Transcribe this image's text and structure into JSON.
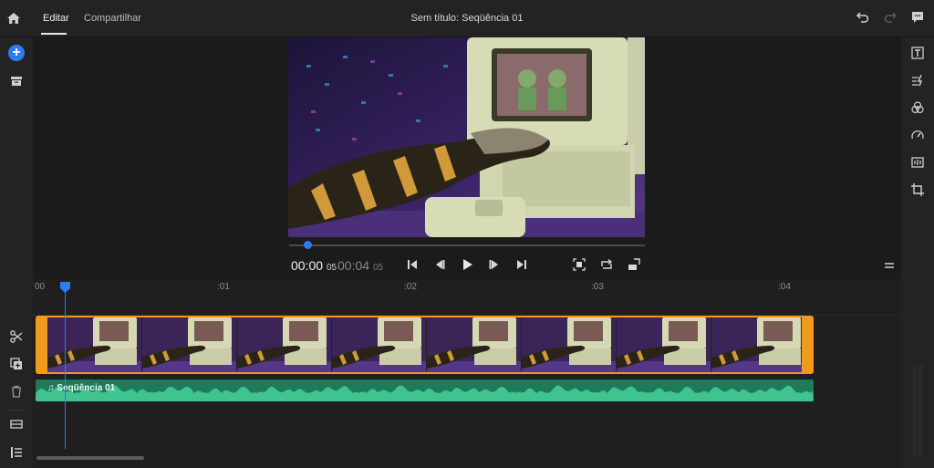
{
  "header": {
    "tabs": [
      {
        "label": "Editar",
        "active": true
      },
      {
        "label": "Compartilhar",
        "active": false
      }
    ],
    "title": "Sem título: Seqüência 01",
    "icons": [
      "home-icon",
      "undo-icon",
      "redo-icon",
      "comment-icon"
    ]
  },
  "left_rail": {
    "icons": [
      "add-icon",
      "archive-icon",
      "scissors-icon",
      "duplicate-icon",
      "trash-icon",
      "track-icon",
      "list-icon"
    ]
  },
  "right_rail": {
    "icons": [
      "titles-icon",
      "transitions-icon",
      "color-icon",
      "speed-icon",
      "audio-icon",
      "crop-icon"
    ]
  },
  "player": {
    "current_time": "00:00",
    "current_frames": "05",
    "total_time": "00:04",
    "total_frames": "05",
    "progress": 0.05
  },
  "timeline": {
    "ruler_ticks": [
      "00",
      ":01",
      ":02",
      ":03",
      ":04"
    ],
    "audio_track_label": "Seqüência 01"
  },
  "colors": {
    "accent": "#2c7cf5",
    "video_clip": "#f29a1b",
    "audio_clip": "#1f7a5a"
  }
}
